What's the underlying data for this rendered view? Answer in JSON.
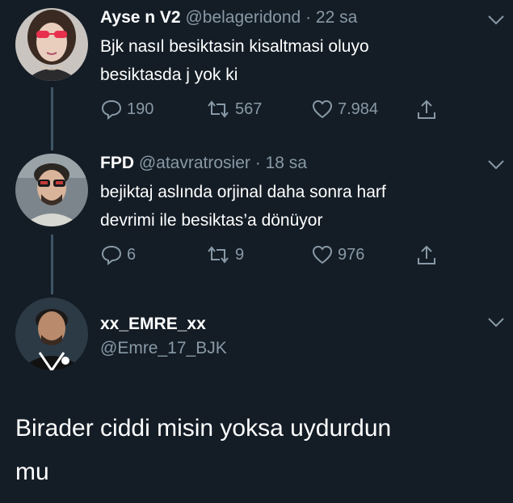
{
  "tweets": [
    {
      "name": "Ayse n V2",
      "handle": "@belageridond",
      "time": "· 22 sa",
      "lines": [
        "Bjk nasıl besiktasin kisaltmasi oluyo",
        "besiktasda j yok ki"
      ],
      "replies": "190",
      "retweets": "567",
      "likes": "7.984"
    },
    {
      "name": "FPD",
      "handle": "@atavratrosier",
      "time": "· 18 sa",
      "lines": [
        "bejiktaj aslında orjinal daha sonra harf",
        "devrimi ile besiktas’a dönüyor"
      ],
      "replies": "6",
      "retweets": "9",
      "likes": "976"
    }
  ],
  "main": {
    "name": "xx_EMRE_xx",
    "handle": "@Emre_17_BJK",
    "lines": [
      "Birader ciddi misin yoksa uydurdun",
      "mu"
    ]
  },
  "colors": {
    "background": "#141d26",
    "muted": "#8899a6",
    "line": "#3d5466"
  },
  "icons": [
    "reply-icon",
    "retweet-icon",
    "like-icon",
    "share-icon",
    "chevron-down-icon"
  ]
}
